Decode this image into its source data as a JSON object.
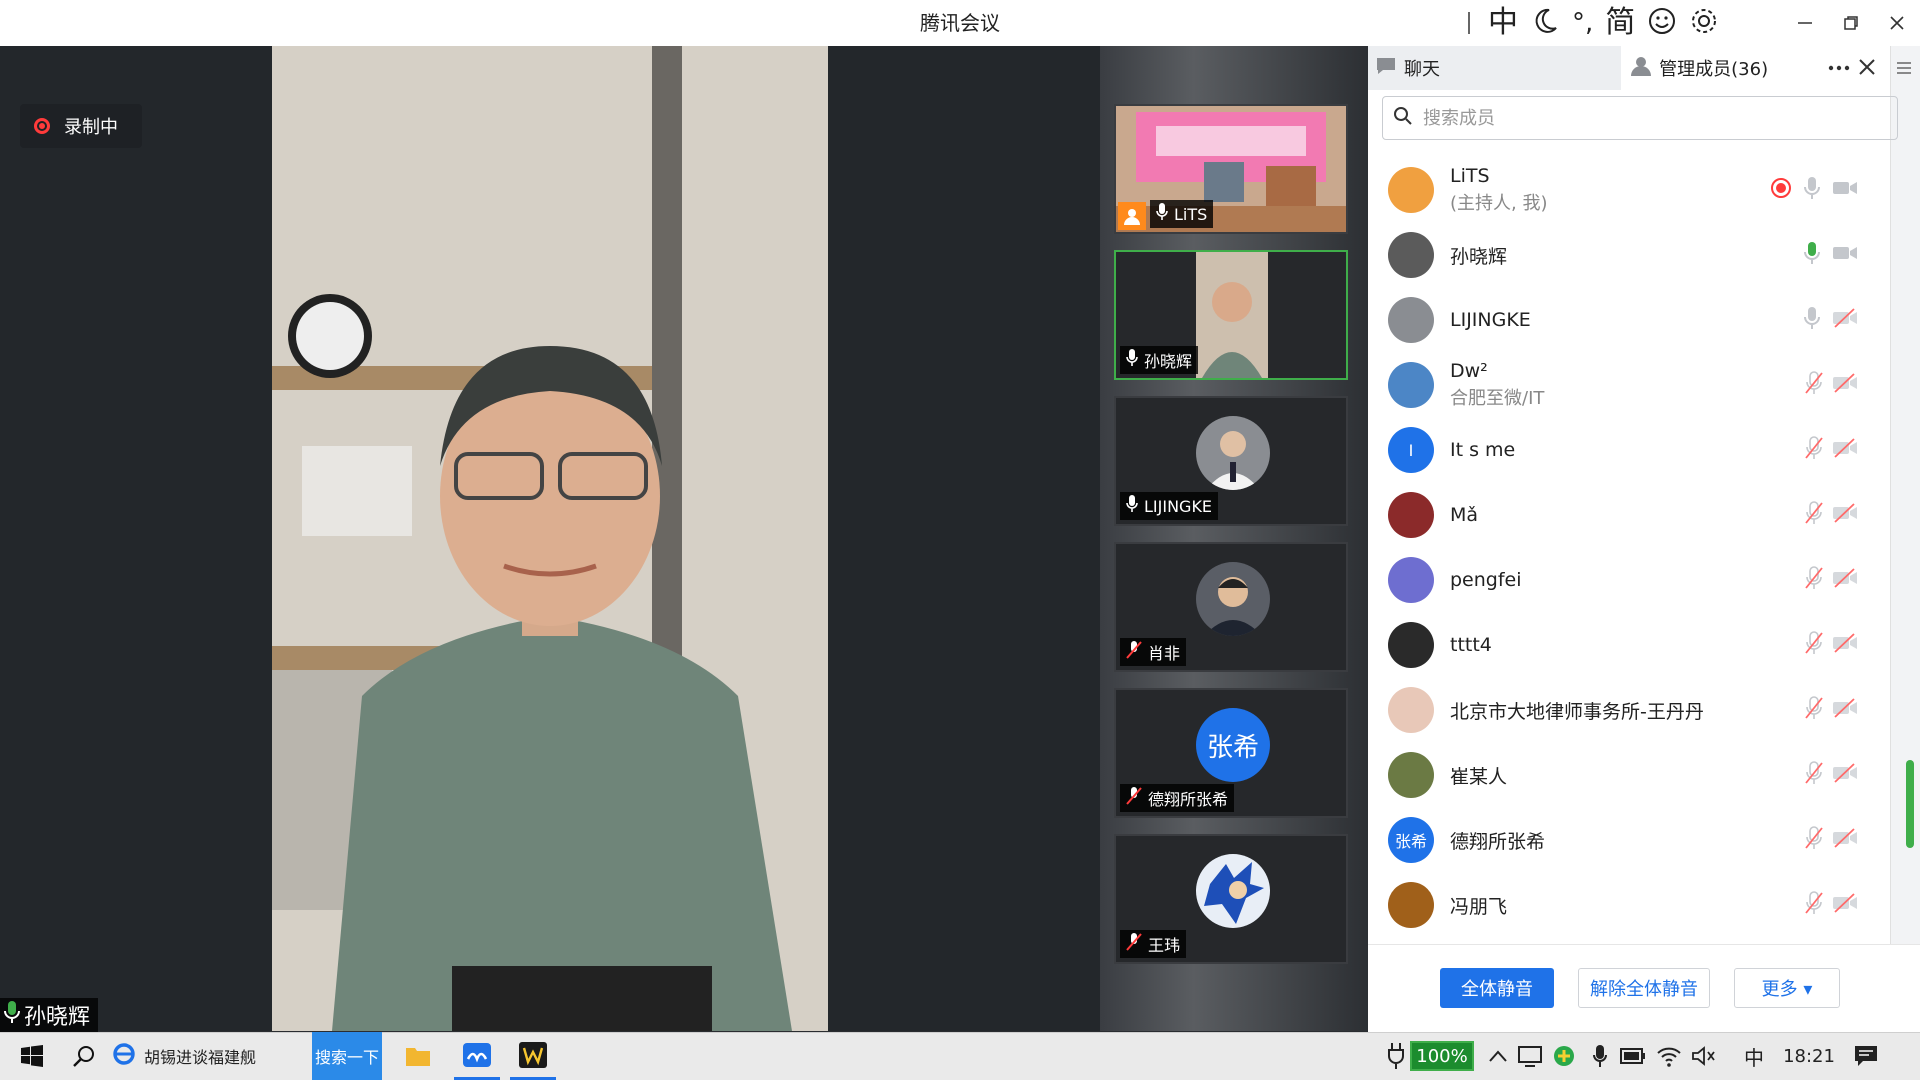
{
  "app": {
    "title": "腾讯会议"
  },
  "ime": {
    "mode": "中",
    "punct": "°,",
    "script": "简"
  },
  "recording": {
    "label": "录制中"
  },
  "speaker": {
    "name": "孙晓辉"
  },
  "gallery": [
    {
      "name": "LiTS"
    },
    {
      "name": "孙晓辉"
    },
    {
      "name": "LIJINGKE"
    },
    {
      "name": "肖非"
    },
    {
      "name": "德翔所张希",
      "avatar_text": "张希"
    },
    {
      "name": "王玮"
    }
  ],
  "panel": {
    "tab_chat": "聊天",
    "tab_members": "管理成员(36)",
    "search_placeholder": "搜索成员",
    "members": [
      {
        "name": "LiTS",
        "sub": "(主持人, 我)",
        "avatar_color": "#f0a040"
      },
      {
        "name": "孙晓辉",
        "sub": "",
        "avatar_color": "#5b5b5b"
      },
      {
        "name": "LIJINGKE",
        "sub": "",
        "avatar_color": "#8a8d92"
      },
      {
        "name": "Dw²",
        "sub": "合肥至微/IT",
        "avatar_color": "#4c86c6"
      },
      {
        "name": "It s me",
        "sub": "",
        "avatar_color": "#1f72e8",
        "avatar_text": "I"
      },
      {
        "name": "Mǎ",
        "sub": "",
        "avatar_color": "#8b2a2a"
      },
      {
        "name": "pengfei",
        "sub": "",
        "avatar_color": "#6e6ed0"
      },
      {
        "name": "tttt4",
        "sub": "",
        "avatar_color": "#2a2a2a"
      },
      {
        "name": "北京市大地律师事务所-王丹丹",
        "sub": "",
        "avatar_color": "#e8c8b8"
      },
      {
        "name": "崔某人",
        "sub": "",
        "avatar_color": "#6b7a44"
      },
      {
        "name": "德翔所张希",
        "sub": "",
        "avatar_color": "#1f72e8",
        "avatar_text": "张希"
      },
      {
        "name": "冯朋飞",
        "sub": "",
        "avatar_color": "#a0601a"
      }
    ],
    "btn_mute_all": "全体静音",
    "btn_unmute_all": "解除全体静音",
    "btn_more": "更多 ▾"
  },
  "taskbar": {
    "ie_text": "胡锡进谈福建舰",
    "search_btn": "搜索一下",
    "battery": "100%",
    "lang": "中",
    "time": "18:21"
  },
  "colors": {
    "accent": "#1f72e8",
    "active_green": "#3fae4a",
    "record_red": "#ff3b3b"
  }
}
